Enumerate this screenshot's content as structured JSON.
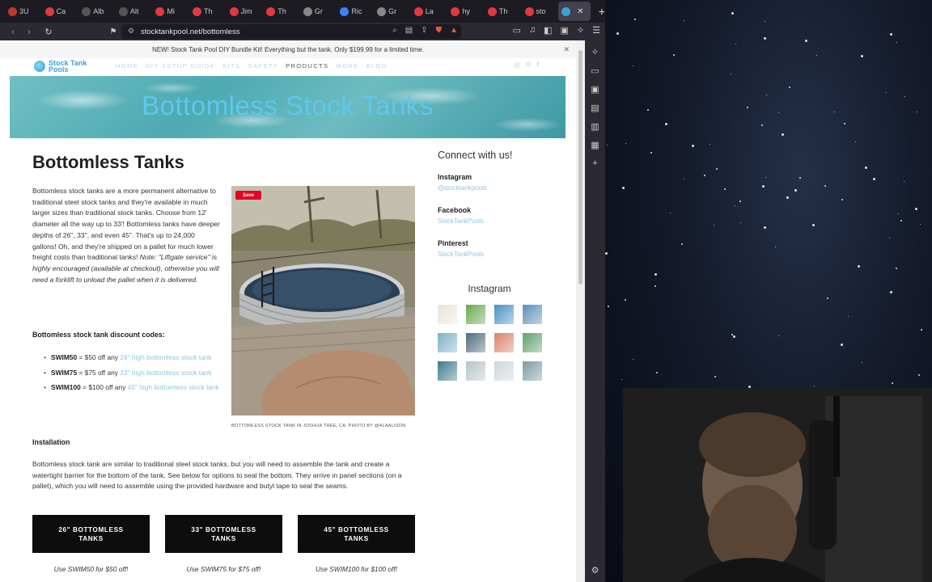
{
  "browser": {
    "tabs": [
      {
        "label": "3U",
        "color": "#c0392b"
      },
      {
        "label": "Ca",
        "color": "#e03a3a"
      },
      {
        "label": "Alb",
        "color": "#555555"
      },
      {
        "label": "Alt",
        "color": "#555555"
      },
      {
        "label": "Mi",
        "color": "#e03a3a"
      },
      {
        "label": "Th",
        "color": "#e03a3a"
      },
      {
        "label": "Jim",
        "color": "#e03a3a"
      },
      {
        "label": "Th",
        "color": "#e03a3a"
      },
      {
        "label": "Gr",
        "color": "#888888"
      },
      {
        "label": "Ric",
        "color": "#3b82f6"
      },
      {
        "label": "Gr",
        "color": "#888888"
      },
      {
        "label": "La",
        "color": "#e03a3a"
      },
      {
        "label": "hy",
        "color": "#e03a3a"
      },
      {
        "label": "Th",
        "color": "#e03a3a"
      },
      {
        "label": "sto",
        "color": "#e03a3a"
      },
      {
        "label": "",
        "color": "#3aa3d8",
        "active": true
      }
    ],
    "url": "stocktankpool.net/bottomless"
  },
  "site": {
    "announcement": "NEW! Stock Tank Pool DIY Bundle Kit! Everything but the tank. Only $199.99 for a limited time.",
    "logo_line1": "Stock Tank",
    "logo_line2": "Pools",
    "nav": {
      "home": "HOME",
      "diy": "DIY SETUP GUIDE",
      "kits": "KITS",
      "safety": "SAFETY",
      "products": "PRODUCTS",
      "more": "MORE",
      "blog": "BLOG"
    },
    "hero_title": "Bottomless Stock Tanks"
  },
  "content": {
    "heading": "Bottomless Tanks",
    "intro_main": "Bottomless stock tanks are a more permanent alternative to traditional steel stock tanks and they're available in much larger sizes than traditional stock tanks. Choose from 12' diameter all the way up to 33'! Bottomless tanks have deeper depths of 26\", 33\", and even 45\". That's up to 24,000 gallons! Oh, and they're shipped on a pallet for much lower freight costs than traditional tanks! ",
    "intro_note": "Note: \"Liftgate service\" is highly encouraged (available at checkout), otherwise you will need a forklift to unload the pallet when it is delivered.",
    "codes_title": "Bottomless stock tank discount codes:",
    "codes": [
      {
        "code": "SWIM50",
        "desc": " = $50 off any ",
        "link": "26\" high bottomless stock tank"
      },
      {
        "code": "SWIM75",
        "desc": " = $75 off any ",
        "link": "33\" high bottomless stock tank"
      },
      {
        "code": "SWIM100",
        "desc": " = $100 off any ",
        "link": "45\" high bottomless stock tank"
      }
    ],
    "photo_save": "Save",
    "photo_caption": "BOTTOMLESS STOCK TANK IN JOSHUA TREE, CA. PHOTO BY @ALAALISON",
    "install_title": "Installation",
    "install_text": "Bottomless stock tank are similar to traditional steel stock tanks, but you will need to assemble the tank and create a watertight barrier for the bottom of the tank. See below for options to seal the bottom. They arrive in panel sections (on a pallet), which you will need to assemble using the provided hardware and butyl tape to seal the seams.",
    "buttons": [
      {
        "label": "26\" BOTTOMLESS TANKS",
        "promo": "Use SWIM50 for $50 off!"
      },
      {
        "label": "33\" BOTTOMLESS TANKS",
        "promo": "Use SWIM75 for $75 off!"
      },
      {
        "label": "45\" BOTTOMLESS TANKS",
        "promo": "Use SWIM100 for $100 off!"
      }
    ]
  },
  "sidebar": {
    "title": "Connect with us!",
    "instagram_label": "Instagram",
    "instagram_handle": "@stocktankpools",
    "facebook_label": "Facebook",
    "facebook_handle": "StockTankPools",
    "pinterest_label": "Pinterest",
    "pinterest_handle": "StockTankPools",
    "insta_title": "Instagram",
    "thumb_colors": [
      "#e9e4dc",
      "#6aa84f",
      "#4a90c2",
      "#5b8fb9",
      "#7fb1c8",
      "#4f6a7a",
      "#d9826b",
      "#5fa06f",
      "#3d7c8c",
      "#b8c4c8",
      "#cfd6da",
      "#7d9aa3"
    ]
  }
}
